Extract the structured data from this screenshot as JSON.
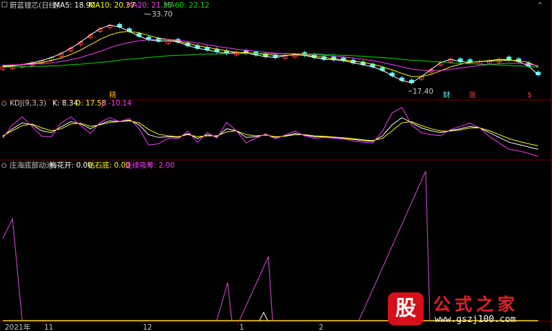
{
  "header": {
    "title": "蔚蓝锂芯(日线)",
    "ma5": "MA5: 18.90",
    "ma10": "MA10: 20.37",
    "ma20": "MA20: 21.36",
    "ma60": "MA60: 22.12"
  },
  "kdj_header": {
    "name": "KDJ(9,3,3)",
    "k": "K: 8.34",
    "d": "D: 17.58",
    "j": "J: -10.14"
  },
  "ind_header": {
    "name": "庄海底部动池",
    "a": "梅花开: 0.00",
    "b": "钻石底: 0.00",
    "c": "连续吸筹: 2.00"
  },
  "annotations": {
    "high": "33.70",
    "low": "17.40",
    "sig1": "精",
    "sig2": "财",
    "sig3": "涨",
    "sig4": "$"
  },
  "x_axis": [
    "2021年",
    "11",
    "12",
    "1",
    "2"
  ],
  "watermark": {
    "badge": "股",
    "title": "公式之家",
    "url": "www.gszj100.com"
  },
  "colors": {
    "up": "#ff3c3c",
    "down": "#54ffff",
    "ma5": "#ffffff",
    "ma10": "#ffff00",
    "ma20": "#ff3cff",
    "ma60": "#00e000",
    "indicator": "#c040c0",
    "label": "#c8c8c8"
  },
  "chart_data": [
    {
      "type": "line",
      "panel": "price",
      "ylim": [
        16,
        35
      ],
      "series": [
        {
          "name": "MA5",
          "values": [
            22.4,
            22.6,
            22.9,
            23.3,
            23.8,
            24.5,
            25.4,
            26.6,
            28.0,
            29.6,
            31.0,
            31.8,
            31.4,
            30.4,
            29.3,
            28.5,
            28.2,
            28.3,
            28.0,
            27.2,
            26.6,
            26.2,
            25.8,
            25.4,
            25.7,
            25.5,
            25.1,
            24.7,
            24.5,
            24.9,
            25.2,
            25.0,
            24.5,
            24.1,
            24.0,
            23.8,
            23.3,
            22.9,
            22.4,
            21.6,
            20.4,
            19.3,
            18.8,
            20.2,
            21.8,
            23.4,
            24.1,
            23.6,
            23.4,
            23.6,
            23.8,
            24.1,
            24.0,
            23.6,
            22.6,
            20.6
          ]
        },
        {
          "name": "MA10",
          "values": [
            22.6,
            22.7,
            22.9,
            23.1,
            23.4,
            23.8,
            24.4,
            25.2,
            26.2,
            27.4,
            28.6,
            29.6,
            30.2,
            30.4,
            30.1,
            29.5,
            28.9,
            28.6,
            28.2,
            27.7,
            27.2,
            26.8,
            26.4,
            26.0,
            25.7,
            25.6,
            25.4,
            25.2,
            25.0,
            25.0,
            25.1,
            25.0,
            24.8,
            24.5,
            24.2,
            24.0,
            23.7,
            23.4,
            23.0,
            22.4,
            21.7,
            20.9,
            20.2,
            20.2,
            20.7,
            21.5,
            22.4,
            23.0,
            23.4,
            23.6,
            23.7,
            23.8,
            23.9,
            23.8,
            23.4,
            22.4
          ]
        },
        {
          "name": "MA20",
          "values": [
            22.8,
            22.8,
            22.9,
            23.0,
            23.1,
            23.3,
            23.6,
            24.0,
            24.5,
            25.2,
            25.9,
            26.7,
            27.4,
            27.9,
            28.3,
            28.5,
            28.6,
            28.6,
            28.4,
            28.1,
            27.8,
            27.4,
            27.0,
            26.7,
            26.4,
            26.1,
            25.9,
            25.7,
            25.5,
            25.4,
            25.3,
            25.2,
            25.1,
            25.0,
            24.8,
            24.6,
            24.4,
            24.1,
            23.8,
            23.4,
            22.9,
            22.4,
            21.9,
            21.6,
            21.5,
            21.6,
            21.8,
            22.1,
            22.4,
            22.7,
            22.9,
            23.1,
            23.2,
            23.2,
            23.0,
            22.6
          ]
        },
        {
          "name": "MA60",
          "values": [
            22.3,
            22.4,
            22.4,
            22.5,
            22.5,
            22.6,
            22.7,
            22.9,
            23.0,
            23.2,
            23.4,
            23.6,
            23.9,
            24.1,
            24.3,
            24.5,
            24.7,
            24.9,
            25.0,
            25.1,
            25.2,
            25.3,
            25.3,
            25.4,
            25.4,
            25.4,
            25.4,
            25.4,
            25.4,
            25.4,
            25.4,
            25.3,
            25.3,
            25.2,
            25.1,
            25.0,
            24.9,
            24.8,
            24.6,
            24.5,
            24.3,
            24.1,
            23.9,
            23.8,
            23.6,
            23.5,
            23.3,
            23.2,
            23.1,
            23.0,
            22.9,
            22.8,
            22.7,
            22.6,
            22.5,
            22.3
          ]
        }
      ]
    },
    {
      "type": "line",
      "panel": "kdj",
      "ylim": [
        -12,
        110
      ],
      "series": [
        {
          "name": "K",
          "values": [
            40,
            60,
            75,
            70,
            55,
            50,
            65,
            78,
            72,
            60,
            72,
            80,
            78,
            82,
            70,
            45,
            38,
            40,
            38,
            48,
            35,
            45,
            40,
            60,
            55,
            38,
            40,
            45,
            38,
            42,
            48,
            44,
            40,
            40,
            38,
            36,
            33,
            30,
            28,
            42,
            70,
            88,
            75,
            62,
            55,
            50,
            56,
            60,
            66,
            62,
            50,
            38,
            26,
            20,
            14,
            8
          ]
        },
        {
          "name": "D",
          "values": [
            42,
            55,
            68,
            72,
            62,
            55,
            60,
            72,
            74,
            66,
            70,
            76,
            78,
            80,
            75,
            58,
            46,
            42,
            40,
            45,
            40,
            42,
            42,
            52,
            55,
            45,
            42,
            44,
            40,
            41,
            45,
            45,
            42,
            41,
            39,
            37,
            35,
            32,
            30,
            36,
            55,
            75,
            78,
            68,
            60,
            54,
            54,
            57,
            62,
            62,
            55,
            45,
            35,
            28,
            22,
            17
          ]
        },
        {
          "name": "J",
          "values": [
            36,
            70,
            90,
            66,
            41,
            40,
            75,
            90,
            68,
            48,
            76,
            88,
            78,
            86,
            60,
            19,
            22,
            36,
            34,
            54,
            25,
            51,
            36,
            76,
            55,
            24,
            36,
            47,
            34,
            44,
            54,
            42,
            36,
            38,
            36,
            34,
            29,
            26,
            24,
            54,
            100,
            114,
            69,
            50,
            45,
            42,
            58,
            66,
            74,
            62,
            40,
            24,
            8,
            4,
            -2,
            -10
          ]
        }
      ]
    },
    {
      "type": "line",
      "panel": "indicator",
      "ylim": [
        0,
        100
      ],
      "series": [
        {
          "name": "庄海底部动池",
          "values": [
            55,
            68,
            0,
            0,
            0,
            0,
            0,
            0,
            0,
            0,
            0,
            0,
            0,
            0,
            0,
            0,
            0,
            0,
            0,
            0,
            0,
            0,
            0,
            0,
            0,
            0,
            0,
            0,
            0,
            0,
            0,
            0,
            0,
            0,
            0,
            0,
            0,
            0,
            0,
            0,
            0,
            0,
            0,
            0,
            0,
            0,
            0,
            0,
            0,
            0,
            0,
            0,
            0,
            0,
            0,
            0
          ]
        },
        {
          "name": "连续吸筹",
          "values": [
            0,
            0,
            0,
            0,
            0,
            0,
            0,
            0,
            0,
            0,
            0,
            0,
            0,
            0,
            0,
            0,
            0,
            0,
            0,
            0,
            0,
            0,
            0,
            0,
            0,
            0,
            0,
            0,
            0,
            0,
            0,
            0,
            0,
            0,
            0,
            0,
            0,
            0,
            0,
            0,
            0,
            0,
            0,
            0,
            0,
            0,
            0,
            0,
            0,
            0,
            0,
            0,
            0,
            0,
            0,
            0
          ]
        }
      ]
    }
  ]
}
